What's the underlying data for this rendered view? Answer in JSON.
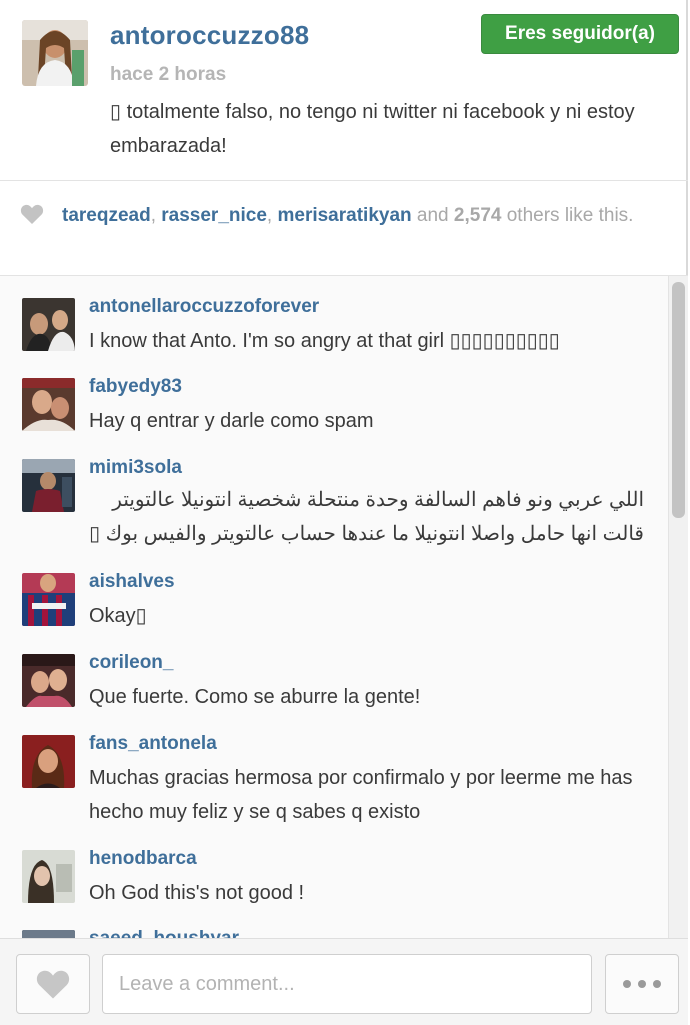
{
  "post": {
    "owner": "antoroccuzzo88",
    "time": "hace 2 horas",
    "follow_label": "Eres seguidor(a)",
    "caption": "▯ totalmente falso, no tengo ni twitter ni facebook y ni estoy embarazada!"
  },
  "likes": {
    "users": [
      "tareqzead",
      "rasser_nice",
      "merisaratikyan"
    ],
    "sep1": ", ",
    "sep2": ", ",
    "and": " and ",
    "count": "2,574",
    "suffix": " others like this."
  },
  "comments": [
    {
      "user": "antonellaroccuzzoforever",
      "text": "I know that Anto. I'm so angry at that girl ▯▯▯▯▯▯▯▯▯▯"
    },
    {
      "user": "fabyedy83",
      "text": "Hay q entrar y darle como spam"
    },
    {
      "user": "mimi3sola",
      "text": "اللي عربي ونو فاهم السالفة وحدة منتحلة شخصية انتونيلا عالتويتر قالت انها حامل واصلا انتونيلا ما عندها حساب عالتويتر والفيس بوك ▯"
    },
    {
      "user": "aishalves",
      "text": "Okay▯"
    },
    {
      "user": "corileon_",
      "text": "Que fuerte. Como se aburre la gente!"
    },
    {
      "user": "fans_antonela",
      "text": "Muchas gracias hermosa por confirmalo y por leerme me has hecho muy feliz y se q sabes q existo"
    },
    {
      "user": "henodbarca",
      "text": "Oh God this's not good !"
    },
    {
      "user": "saeed_houshyar",
      "text": ""
    }
  ],
  "footer": {
    "comment_placeholder": "Leave a comment..."
  },
  "icons": {
    "like": "heart-icon",
    "more": "more-dots-icon"
  },
  "colors": {
    "username": "#3f6f9a",
    "follow_button": "#3f9f44",
    "muted": "#a8a8a8"
  }
}
